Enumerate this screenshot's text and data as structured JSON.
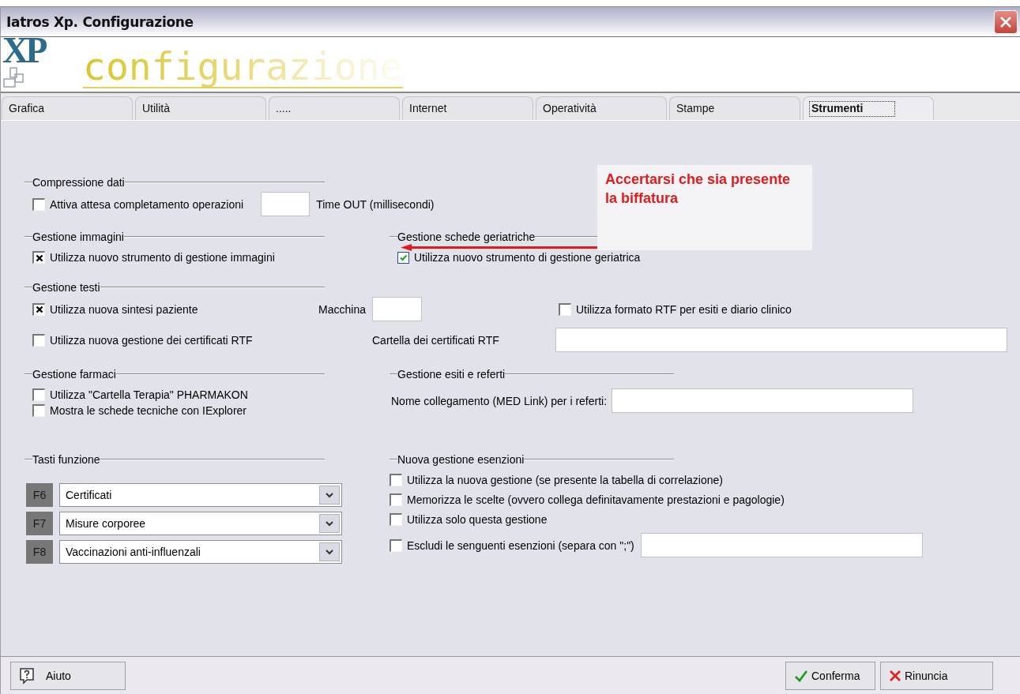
{
  "window": {
    "title": "Iatros Xp. Configurazione"
  },
  "banner": {
    "logo": "XP",
    "title": "configurazione"
  },
  "tabs": [
    {
      "label": "Grafica",
      "selected": false
    },
    {
      "label": "Utilità",
      "selected": false
    },
    {
      "label": ".....",
      "selected": false
    },
    {
      "label": "Internet",
      "selected": false
    },
    {
      "label": "Operatività",
      "selected": false
    },
    {
      "label": "Stampe",
      "selected": false
    },
    {
      "label": "Strumenti",
      "selected": true
    }
  ],
  "compressione_dati": {
    "heading": "Compressione dati",
    "checkbox": {
      "kind": "classic",
      "label": "Attiva attesa completamento operazioni",
      "checked": false
    },
    "timeout_label": "Time OUT (millisecondi)"
  },
  "gestione_immagini": {
    "heading": "Gestione immagini",
    "checkbox": {
      "kind": "classic",
      "label": "Utilizza nuovo strumento di gestione immagini",
      "checked": true
    }
  },
  "gestione_schede_geriatriche": {
    "heading": "Gestione schede geriatriche",
    "checkbox": {
      "kind": "themed",
      "label": "Utilizza nuovo strumento di gestione geriatrica",
      "checked": true
    }
  },
  "gestione_testi": {
    "heading": "Gestione testi",
    "sintesi_checkbox": {
      "kind": "classic",
      "label": "Utilizza nuova sintesi paziente",
      "checked": true
    },
    "machine_label": "Macchina",
    "rtf_format_checkbox": {
      "kind": "classic",
      "label": "Utilizza formato RTF per esiti e diario clinico",
      "checked": false
    },
    "certificates_checkbox": {
      "kind": "classic",
      "label": "Utilizza nuova gestione dei certificati RTF",
      "checked": false
    },
    "folder_label": "Cartella dei certificati RTF"
  },
  "gestione_farmaci": {
    "heading": "Gestione farmaci",
    "checkboxes": [
      {
        "kind": "classic",
        "label": "Utilizza \"Cartella Terapia\" PHARMAKON",
        "checked": false
      },
      {
        "kind": "classic",
        "label": "Mostra le schede tecniche con IExplorer",
        "checked": false
      }
    ]
  },
  "gestione_esiti": {
    "heading": "Gestione esiti e referti",
    "link_label": "Nome collegamento (MED Link) per i referti:"
  },
  "tasti_funzione": {
    "heading": "Tasti funzione",
    "keys": [
      {
        "key": "F6",
        "value": "Certificati"
      },
      {
        "key": "F7",
        "value": "Misure corporee"
      },
      {
        "key": "F8",
        "value": "Vaccinazioni anti-influenzali"
      }
    ]
  },
  "esenzioni": {
    "heading": "Nuova gestione esenzioni",
    "checkboxes": [
      {
        "kind": "classic",
        "label": "Utilizza la nuova gestione (se presente la tabella di correlazione)",
        "checked": false
      },
      {
        "kind": "classic",
        "label": "Memorizza le scelte (ovvero collega definitavamente prestazioni e pagologie)",
        "checked": false
      },
      {
        "kind": "classic",
        "label": "Utilizza solo questa gestione",
        "checked": false
      },
      {
        "kind": "classic",
        "label": "Escludi le senguenti esenzioni (separa con \";\")",
        "checked": false
      }
    ]
  },
  "annotation": {
    "text": "Accertarsi che sia presente la biffatura"
  },
  "buttons": {
    "help": "Aiuto",
    "confirm": "Conferma",
    "cancel": "Rinuncia"
  }
}
